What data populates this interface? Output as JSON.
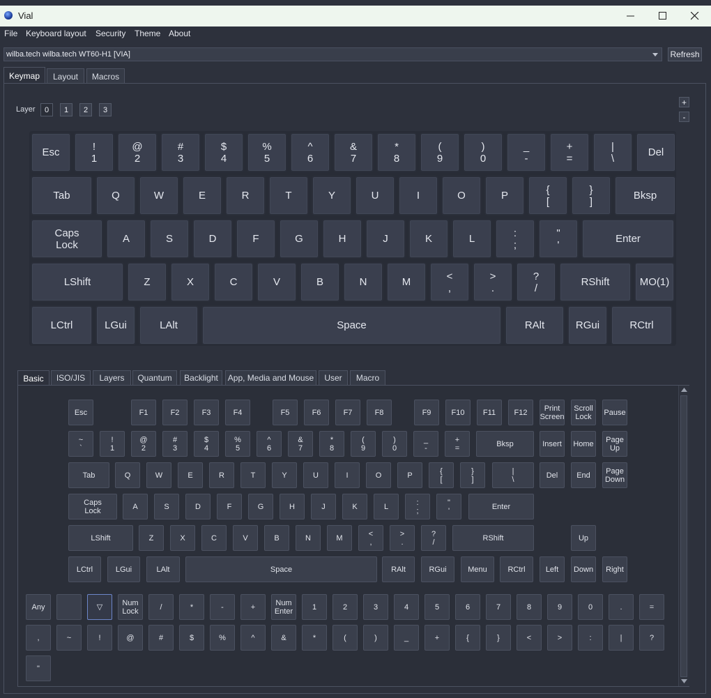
{
  "window": {
    "title": "Vial"
  },
  "menu": [
    "File",
    "Keyboard layout",
    "Security",
    "Theme",
    "About"
  ],
  "device": {
    "selected": "wilba.tech wilba.tech WT60-H1 [VIA]",
    "refresh_label": "Refresh"
  },
  "tabs": [
    "Keymap",
    "Layout",
    "Macros"
  ],
  "layer": {
    "label": "Layer",
    "buttons": [
      "0",
      "1",
      "2",
      "3"
    ],
    "plus": "+",
    "minus": "-"
  },
  "keymap_rows": [
    [
      "Esc",
      "!\n1",
      "@\n2",
      "#\n3",
      "$\n4",
      "%\n5",
      "^\n6",
      "&\n7",
      "*\n8",
      "(\n9",
      ")\n0",
      "_\n-",
      "+\n=",
      "|\n\\",
      "Del"
    ],
    [
      "Tab",
      "Q",
      "W",
      "E",
      "R",
      "T",
      "Y",
      "U",
      "I",
      "O",
      "P",
      "{\n[",
      "}\n]",
      "Bksp"
    ],
    [
      "Caps\nLock",
      "A",
      "S",
      "D",
      "F",
      "G",
      "H",
      "J",
      "K",
      "L",
      ":\n;",
      "\"\n'",
      "Enter"
    ],
    [
      "LShift",
      "Z",
      "X",
      "C",
      "V",
      "B",
      "N",
      "M",
      "<\n,",
      ">\n.",
      "?\n/",
      "RShift",
      "MO(1)"
    ],
    [
      "LCtrl",
      "LGui",
      "LAlt",
      "Space",
      "RAlt",
      "RGui",
      "RCtrl"
    ]
  ],
  "keycode_tabs": [
    "Basic",
    "ISO/JIS",
    "Layers",
    "Quantum",
    "Backlight",
    "App, Media and Mouse",
    "User",
    "Macro"
  ],
  "palette_rows": [
    [
      "Esc",
      "F1",
      "F2",
      "F3",
      "F4",
      "F5",
      "F6",
      "F7",
      "F8",
      "F9",
      "F10",
      "F11",
      "F12",
      "Print\nScreen",
      "Scroll\nLock",
      "Pause"
    ],
    [
      "~\n`",
      "!\n1",
      "@\n2",
      "#\n3",
      "$\n4",
      "%\n5",
      "^\n6",
      "&\n7",
      "*\n8",
      "(\n9",
      ")\n0",
      "_\n-",
      "+\n=",
      "Bksp",
      "Insert",
      "Home",
      "Page\nUp"
    ],
    [
      "Tab",
      "Q",
      "W",
      "E",
      "R",
      "T",
      "Y",
      "U",
      "I",
      "O",
      "P",
      "{\n[",
      "}\n]",
      "|\n\\",
      "Del",
      "End",
      "Page\nDown"
    ],
    [
      "Caps\nLock",
      "A",
      "S",
      "D",
      "F",
      "G",
      "H",
      "J",
      "K",
      "L",
      ":\n;",
      "\"\n'",
      "Enter"
    ],
    [
      "LShift",
      "Z",
      "X",
      "C",
      "V",
      "B",
      "N",
      "M",
      "<\n,",
      ">\n.",
      "?\n/",
      "RShift",
      "Up"
    ],
    [
      "LCtrl",
      "LGui",
      "LAlt",
      "Space",
      "RAlt",
      "RGui",
      "Menu",
      "RCtrl",
      "Left",
      "Down",
      "Right"
    ]
  ],
  "numpad_rows": [
    [
      "Any",
      "",
      "▽",
      "Num\nLock",
      "/",
      "*",
      "-",
      "+",
      "Num\nEnter",
      "1",
      "2",
      "3",
      "4",
      "5",
      "6",
      "7",
      "8",
      "9",
      "0",
      ".",
      "="
    ],
    [
      ",",
      "~",
      "!",
      "@",
      "#",
      "$",
      "%",
      "^",
      "&",
      "*",
      "(",
      ")",
      "_",
      "+",
      "{",
      "}",
      "<",
      ">",
      ":",
      "|",
      "?"
    ],
    [
      "\""
    ]
  ]
}
